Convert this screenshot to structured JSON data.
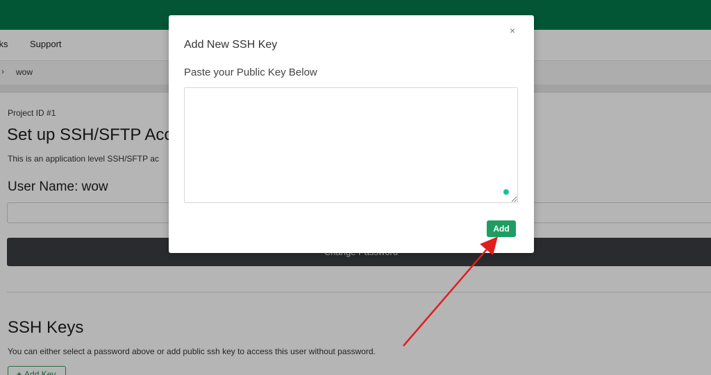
{
  "nav": {
    "items": [
      {
        "label": "sks"
      },
      {
        "label": "Support"
      }
    ]
  },
  "breadcrumb": {
    "chevron": "›",
    "current": "wow"
  },
  "content": {
    "project_id": "Project ID #1",
    "setup_title": "Set up SSH/SFTP Acc",
    "setup_desc": "This is an application level SSH/SFTP ac",
    "username": "User Name: wow",
    "password_placeholder": "",
    "change_password_label": "Change Password",
    "ssh_title": "SSH Keys",
    "ssh_desc": "You can either select a password above or add public ssh key to access this user without password.",
    "add_key_label": "Add Key"
  },
  "modal": {
    "title": "Add New SSH Key",
    "close_icon": "×",
    "label": "Paste your Public Key Below",
    "textarea_value": "",
    "add_label": "Add"
  },
  "colors": {
    "brand_green": "#047a4d",
    "button_green": "#1e9d63",
    "dark_button": "#3a3d42",
    "annotation_arrow": "#e01e1e"
  }
}
